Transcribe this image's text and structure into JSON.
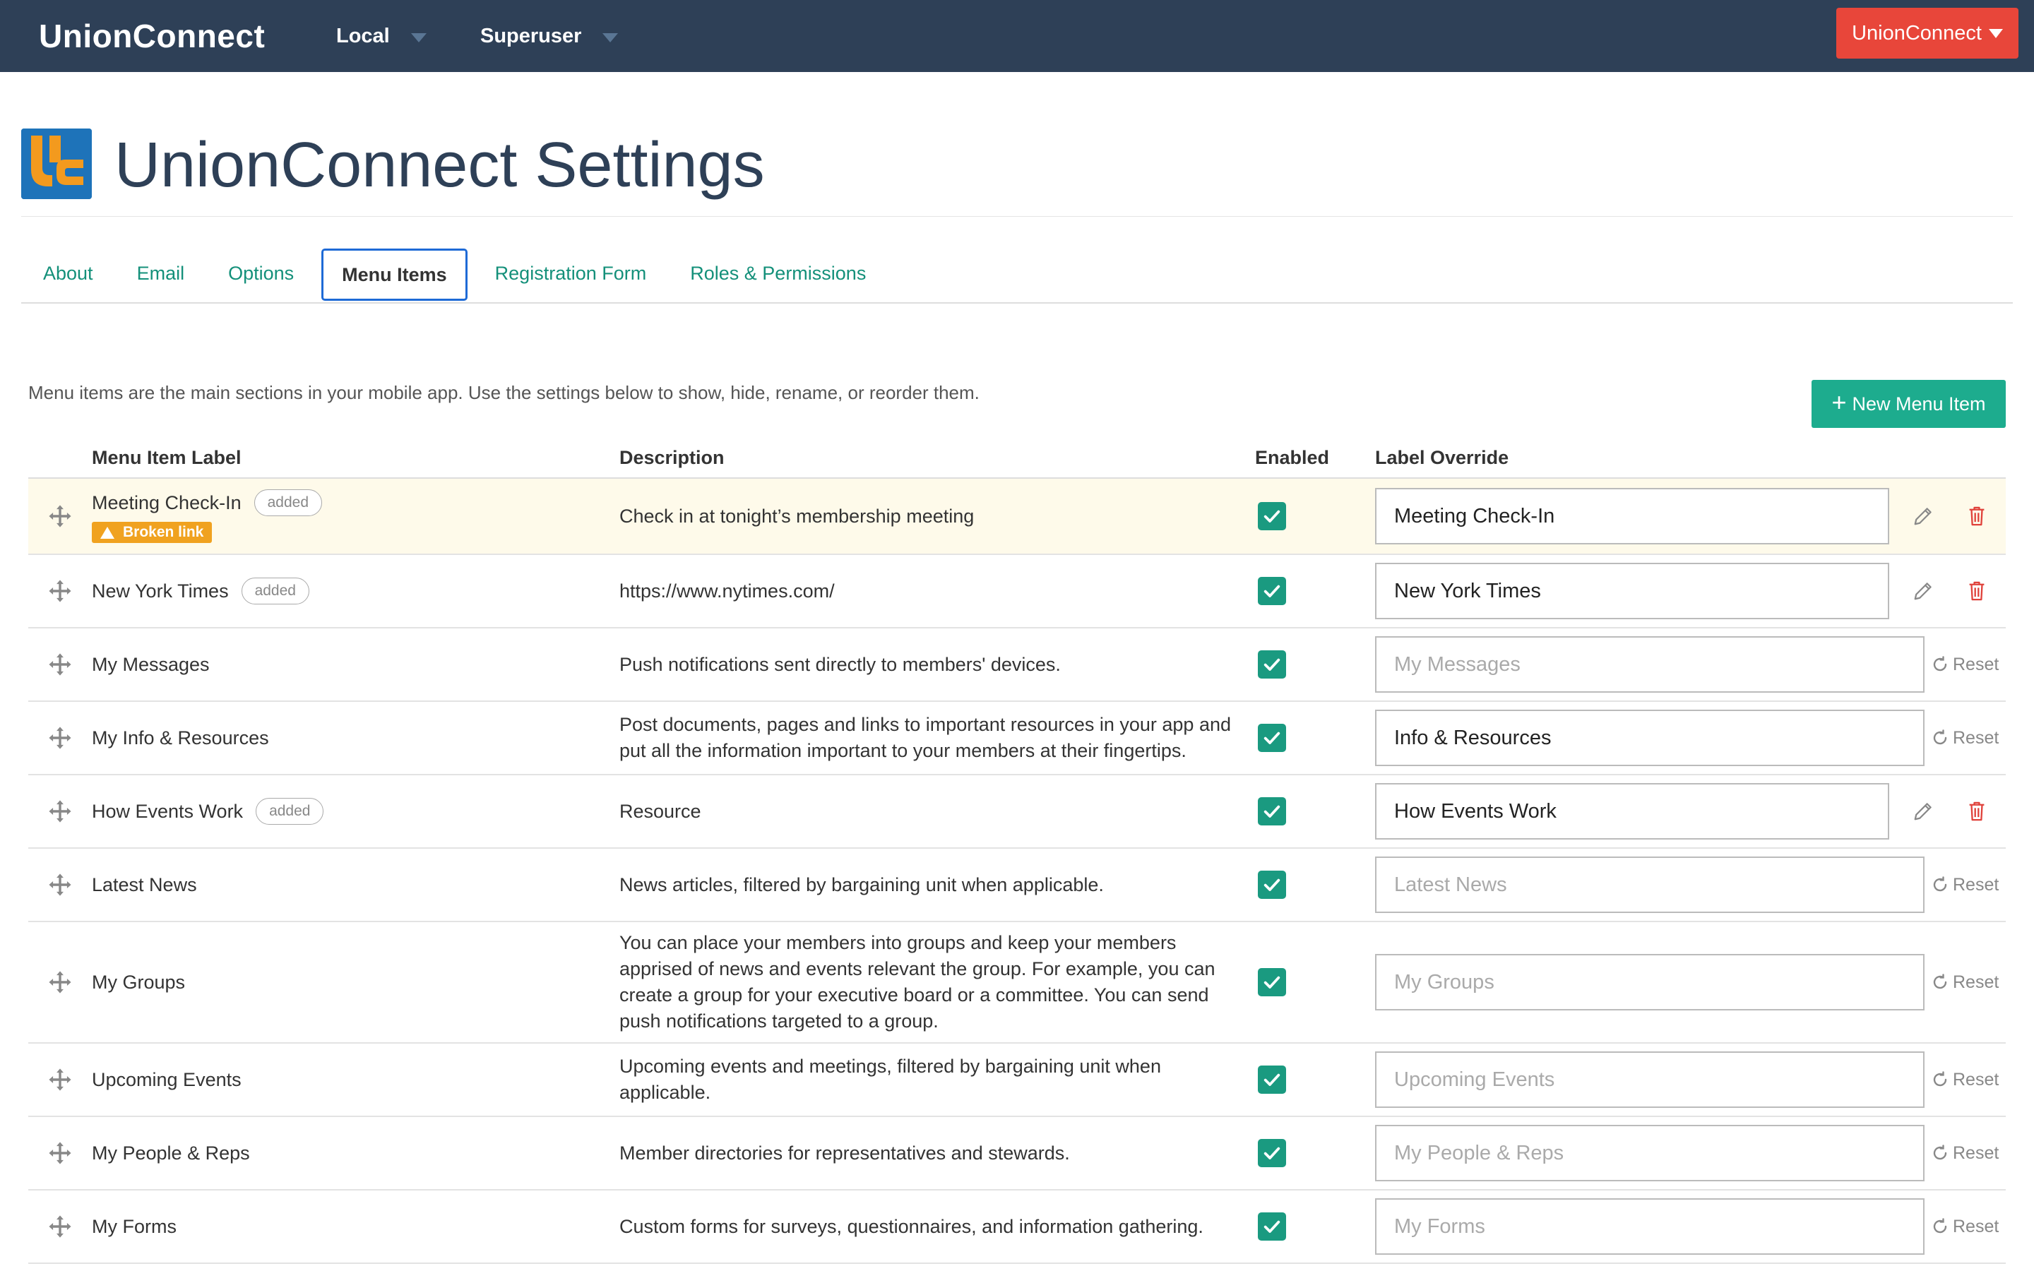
{
  "navbar": {
    "brand": "UnionConnect",
    "local_label": "Local",
    "user_label": "Superuser",
    "account_button": "UnionConnect"
  },
  "header": {
    "title": "UnionConnect Settings"
  },
  "tabs": [
    {
      "label": "About",
      "active": false
    },
    {
      "label": "Email",
      "active": false
    },
    {
      "label": "Options",
      "active": false
    },
    {
      "label": "Menu Items",
      "active": true
    },
    {
      "label": "Registration Form",
      "active": false
    },
    {
      "label": "Roles & Permissions",
      "active": false
    }
  ],
  "intro_text": "Menu items are the main sections in your mobile app. Use the settings below to show, hide, rename, or reorder them.",
  "new_button": "New Menu Item",
  "table": {
    "headers": {
      "label": "Menu Item Label",
      "description": "Description",
      "enabled": "Enabled",
      "override": "Label Override"
    },
    "added_badge": "added",
    "broken_badge": "Broken link",
    "reset_label": "Reset",
    "rows": [
      {
        "label": "Meeting Check-In",
        "added": true,
        "broken": true,
        "description": "Check in at tonight’s membership meeting",
        "enabled": true,
        "override": "Meeting Check-In",
        "placeholder": false
      },
      {
        "label": "New York Times",
        "added": true,
        "broken": false,
        "description": "https://www.nytimes.com/",
        "enabled": true,
        "override": "New York Times",
        "placeholder": false
      },
      {
        "label": "My Messages",
        "added": false,
        "broken": false,
        "description": "Push notifications sent directly to members' devices.",
        "enabled": true,
        "override": "My Messages",
        "placeholder": true
      },
      {
        "label": "My Info & Resources",
        "added": false,
        "broken": false,
        "description": "Post documents, pages and links to important resources in your app and put all the information important to your members at their fingertips.",
        "enabled": true,
        "override": "Info & Resources",
        "placeholder": false
      },
      {
        "label": "How Events Work",
        "added": true,
        "broken": false,
        "description": "Resource",
        "enabled": true,
        "override": "How Events Work",
        "placeholder": false
      },
      {
        "label": "Latest News",
        "added": false,
        "broken": false,
        "description": "News articles, filtered by bargaining unit when applicable.",
        "enabled": true,
        "override": "Latest News",
        "placeholder": true
      },
      {
        "label": "My Groups",
        "added": false,
        "broken": false,
        "description": "You can place your members into groups and keep your members apprised of news and events relevant the group. For example, you can create a group for your executive board or a committee. You can send push notifications targeted to a group.",
        "enabled": true,
        "override": "My Groups",
        "placeholder": true
      },
      {
        "label": "Upcoming Events",
        "added": false,
        "broken": false,
        "description": "Upcoming events and meetings, filtered by bargaining unit when applicable.",
        "enabled": true,
        "override": "Upcoming Events",
        "placeholder": true
      },
      {
        "label": "My People & Reps",
        "added": false,
        "broken": false,
        "description": "Member directories for representatives and stewards.",
        "enabled": true,
        "override": "My People & Reps",
        "placeholder": true
      },
      {
        "label": "My Forms",
        "added": false,
        "broken": false,
        "description": "Custom forms for surveys, questionnaires, and information gathering.",
        "enabled": true,
        "override": "My Forms",
        "placeholder": true
      }
    ]
  },
  "colors": {
    "navbar": "#2e4057",
    "accent_red": "#e8463a",
    "accent_green": "#1dac8e",
    "tab_text": "#14907a",
    "warning": "#f0a220"
  }
}
